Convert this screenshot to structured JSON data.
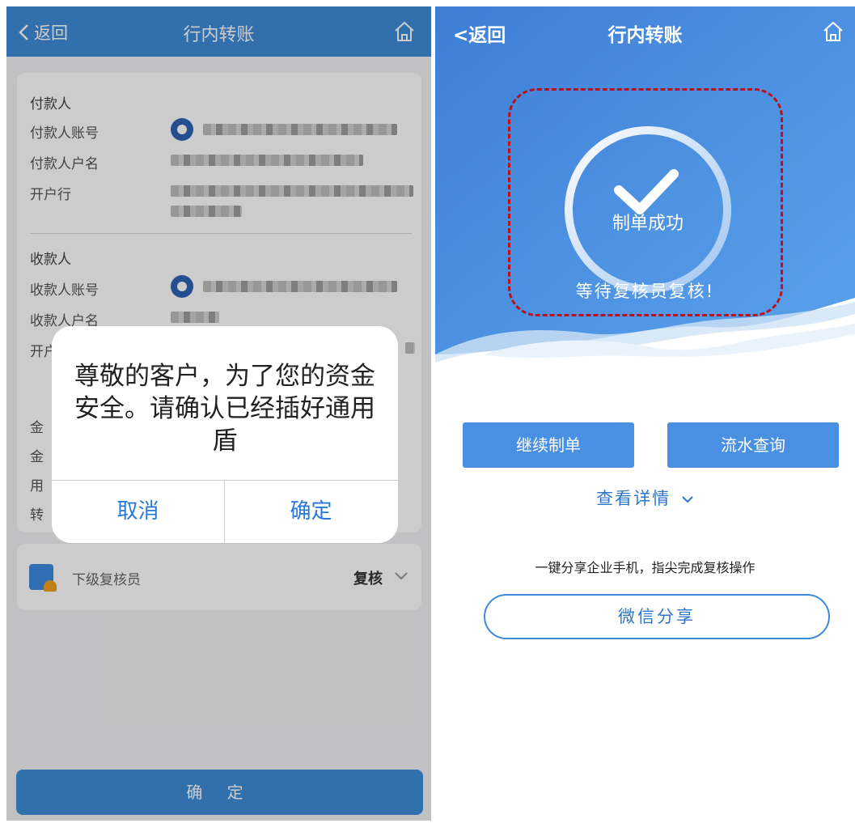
{
  "left_screen": {
    "nav": {
      "back_label": "返回",
      "title": "行内转账"
    },
    "payer": {
      "section_label": "付款人",
      "account_label": "付款人账号",
      "name_label": "付款人户名",
      "bank_label": "开户行"
    },
    "payee": {
      "section_label": "收款人",
      "account_label": "收款人账号",
      "name_label": "收款人户名",
      "bank_label": "开户行"
    },
    "obscured_labels": [
      "金",
      "金",
      "用",
      "转"
    ],
    "approver": {
      "label": "下级复核员",
      "value": "复核"
    },
    "confirm_button_label": "确 定",
    "dialog": {
      "message": "尊敬的客户，为了您的资金安全。请确认已经插好通用盾",
      "cancel_label": "取消",
      "confirm_label": "确定"
    }
  },
  "right_screen": {
    "nav": {
      "back_label": "<返回",
      "title": "行内转账"
    },
    "status": {
      "title": "制单成功",
      "subtitle": "等待复核员复核!"
    },
    "buttons": {
      "continue_label": "继续制单",
      "query_label": "流水查询"
    },
    "detail_link_label": "查看详情",
    "share_hint": "一键分享企业手机，指尖完成复核操作",
    "wechat_share_label": "微信分享"
  },
  "colors": {
    "primary_blue": "#3e8bd9",
    "dialog_button_blue": "#2a78d6",
    "highlight_red": "#b8121e",
    "bank_logo_blue": "#2f62b6",
    "approver_badge_orange": "#f0a020"
  },
  "icons": [
    "chevron-left-icon",
    "home-icon",
    "bank-logo-icon",
    "approver-icon",
    "chevron-down-icon",
    "checkmark-icon"
  ]
}
